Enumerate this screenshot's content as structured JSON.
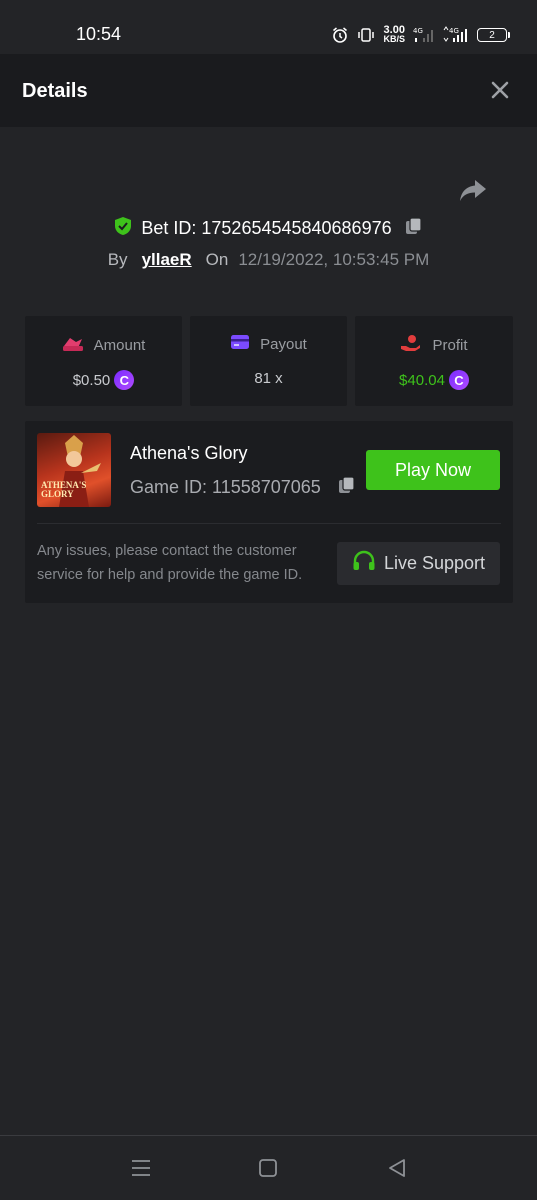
{
  "status_bar": {
    "time": "10:54",
    "net_speed_value": "3.00",
    "net_speed_unit": "KB/S",
    "network_1": "4G",
    "network_2": "4G",
    "battery": "2"
  },
  "header": {
    "title": "Details",
    "close_icon": "close-icon"
  },
  "bet": {
    "id_label": "Bet ID: 1752654545840686976",
    "by_label": "By",
    "username": "yllaeR",
    "on_label": "On",
    "date": "12/19/2022, 10:53:45 PM"
  },
  "stats": {
    "amount": {
      "label": "Amount",
      "value": "$0.50",
      "icon": "amount-icon",
      "color": "#e23d6e"
    },
    "payout": {
      "label": "Payout",
      "value": "81 x",
      "icon": "card-icon",
      "color": "#7b4bff"
    },
    "profit": {
      "label": "Profit",
      "value": "$40.04",
      "icon": "profit-icon",
      "color": "#3ec21b"
    }
  },
  "game": {
    "name": "Athena's Glory",
    "id_label": "Game ID: 11558707065",
    "thumb_text": "ATHENA'S GLORY",
    "play_label": "Play Now",
    "support_text": "Any issues, please contact the customer service for help and provide the game ID.",
    "support_label": "Live Support"
  },
  "colors": {
    "accent_green": "#3ec21b",
    "coin_purple": "#8a35ff",
    "background": "#232427",
    "card": "#1b1c1f"
  }
}
